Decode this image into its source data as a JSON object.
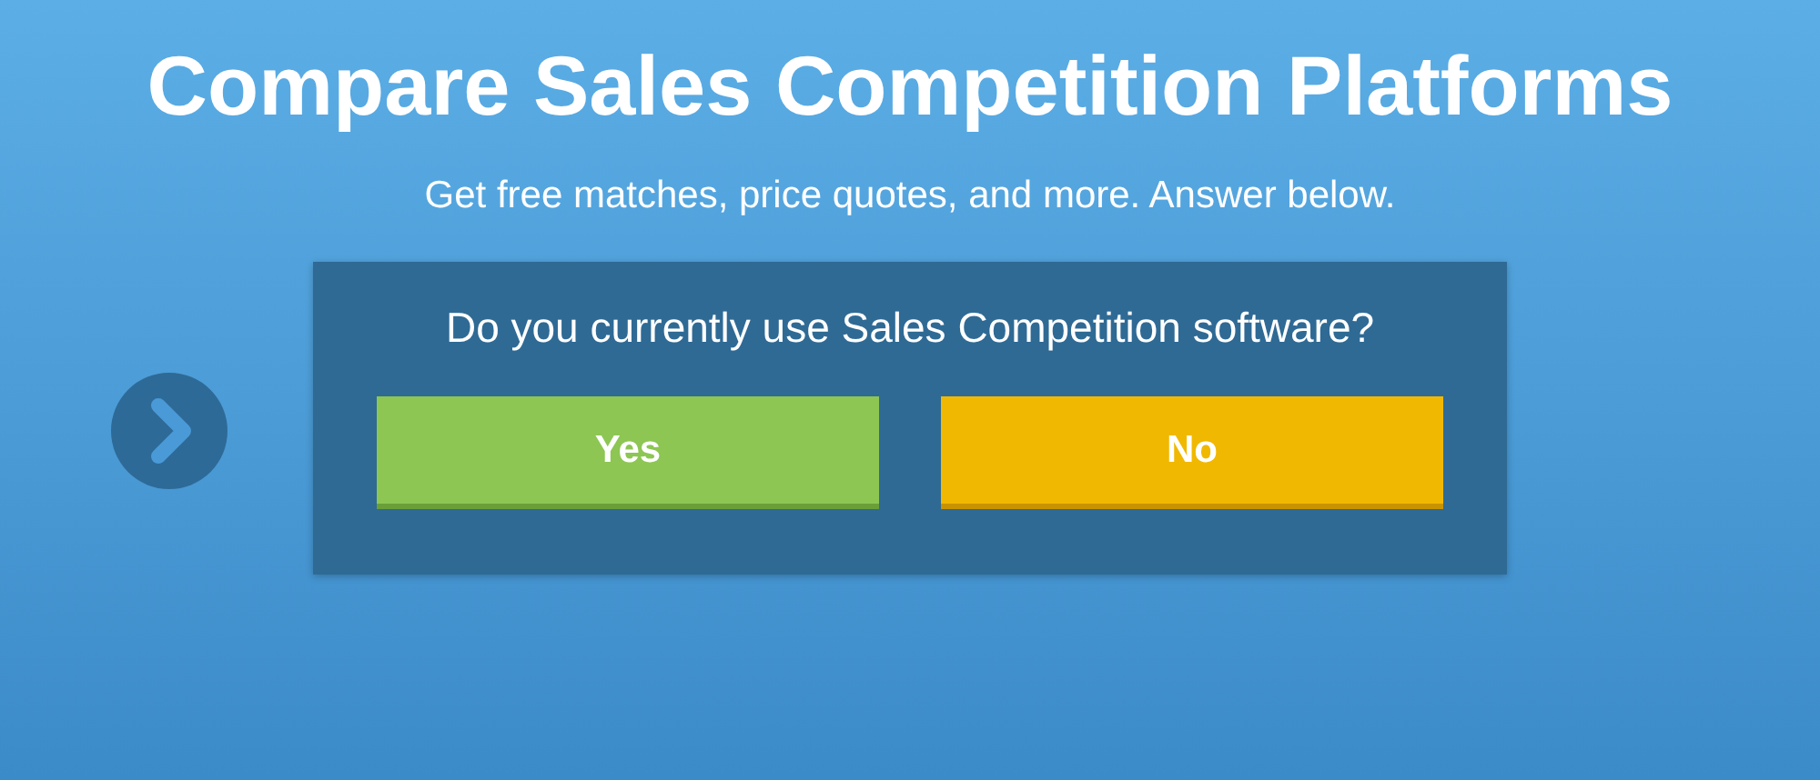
{
  "heading": "Compare Sales Competition Platforms",
  "subheading": "Get free matches, price quotes, and more. Answer below.",
  "question_card": {
    "question": "Do you currently use Sales Competition software?",
    "answers": [
      {
        "label": "Yes",
        "kind": "yes"
      },
      {
        "label": "No",
        "kind": "no"
      }
    ]
  }
}
